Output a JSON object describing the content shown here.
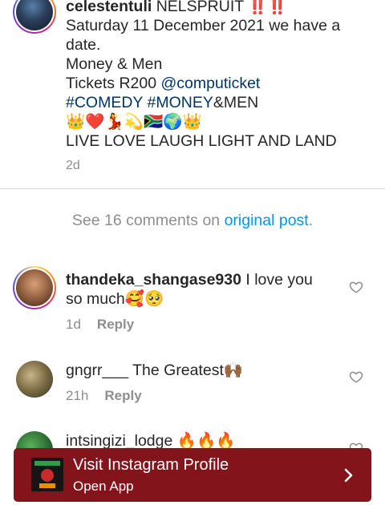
{
  "post": {
    "username": "celestentuli",
    "location_lead": "NELSPRUIT",
    "location_mark": "‼️‼️",
    "line_date": "Saturday 11 December 2021 we have a date.",
    "line_show": "Money & Men",
    "tickets_prefix": "Tickets R200",
    "tickets_mention": "@computicket",
    "tag_comedy": "#COMEDY",
    "tag_money": "#MONEY",
    "tag_suffix": "&MEN",
    "emoji_row": "👑❤️💃💫🇿🇦🌍👑",
    "motto": "LIVE LOVE LAUGH LIGHT AND LAND",
    "time": "2d"
  },
  "see_comments": {
    "prefix": "See 16 comments on",
    "link": "original post",
    "suffix": "."
  },
  "comments": [
    {
      "username": "thandeka_shangase930",
      "text": " I love you so much🥰🥺",
      "time": "1d",
      "reply": "Reply"
    },
    {
      "username": "gngrr___",
      "text": " The Greatest🙌🏾",
      "time": "21h",
      "reply": "Reply"
    },
    {
      "username": "intsingizi_lodge",
      "text": " 🔥🔥🔥",
      "time": "",
      "reply": ""
    }
  ],
  "banner": {
    "title": "Visit Instagram Profile",
    "subtitle": "Open App",
    "color": "#84141b"
  },
  "icons": {
    "heart": "heart-icon",
    "chevron": "chevron-right-icon"
  }
}
